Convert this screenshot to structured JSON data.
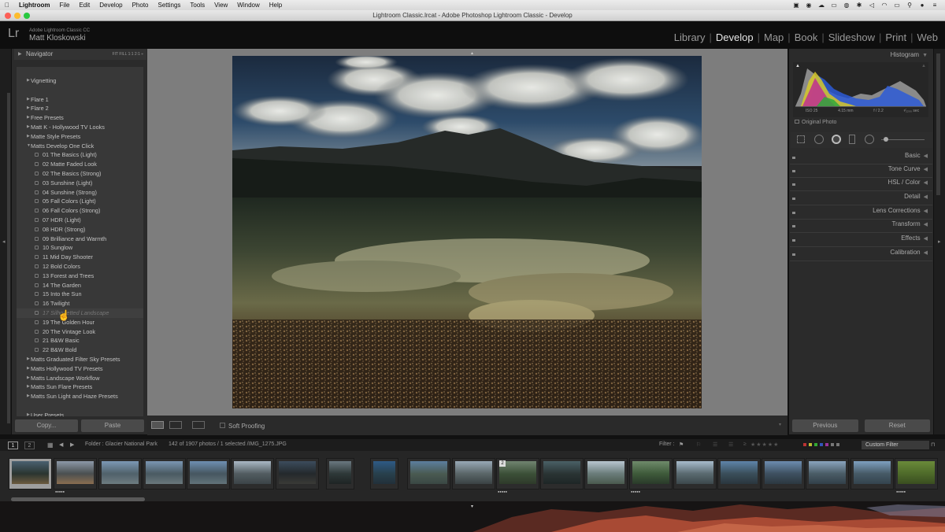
{
  "menubar": {
    "app": "Lightroom",
    "items": [
      "File",
      "Edit",
      "Develop",
      "Photo",
      "Settings",
      "Tools",
      "View",
      "Window",
      "Help"
    ]
  },
  "window_title": "Lightroom Classic.lrcat - Adobe Photoshop Lightroom Classic - Develop",
  "identity": {
    "logo": "Lr",
    "product": "Adobe Lightroom Classic CC",
    "user": "Matt Kloskowski"
  },
  "modules": [
    "Library",
    "Develop",
    "Map",
    "Book",
    "Slideshow",
    "Print",
    "Web"
  ],
  "active_module": "Develop",
  "navigator": {
    "title": "Navigator",
    "zoom_options": "FIT  FILL  1:1  2:1 ÷"
  },
  "presets": [
    {
      "type": "folder",
      "label": "Vignetting"
    },
    {
      "type": "gap"
    },
    {
      "type": "folder",
      "label": "Flare 1"
    },
    {
      "type": "folder",
      "label": "Flare 2"
    },
    {
      "type": "folder",
      "label": "Free Presets"
    },
    {
      "type": "folder",
      "label": "Matt K - Hollywood TV Looks"
    },
    {
      "type": "folder",
      "label": "Matte Style Presets"
    },
    {
      "type": "folder",
      "label": "Matts Develop One Click",
      "open": true
    },
    {
      "type": "item",
      "label": "01 The Basics (Light)"
    },
    {
      "type": "item",
      "label": "02 Matte Faded Look"
    },
    {
      "type": "item",
      "label": "02 The Basics (Strong)"
    },
    {
      "type": "item",
      "label": "03 Sunshine (Light)"
    },
    {
      "type": "item",
      "label": "04 Sunshine (Strong)"
    },
    {
      "type": "item",
      "label": "05 Fall Colors (Light)"
    },
    {
      "type": "item",
      "label": "06 Fall Colors (Strong)"
    },
    {
      "type": "item",
      "label": "07 HDR (Light)"
    },
    {
      "type": "item",
      "label": "08 HDR (Strong)"
    },
    {
      "type": "item",
      "label": "09 Brilliance and Warmth"
    },
    {
      "type": "item",
      "label": "10 Sunglow"
    },
    {
      "type": "item",
      "label": "11 Mid Day Shooter"
    },
    {
      "type": "item",
      "label": "12 Bold Colors"
    },
    {
      "type": "item",
      "label": "13 Forest and Trees"
    },
    {
      "type": "item",
      "label": "14 The Garden"
    },
    {
      "type": "item",
      "label": "15 Into the Sun"
    },
    {
      "type": "item",
      "label": "16 Twilight"
    },
    {
      "type": "item",
      "label": "17 Silhouetted Landscape",
      "hover": true
    },
    {
      "type": "item",
      "label": "19 The Golden Hour"
    },
    {
      "type": "item",
      "label": "20 The Vintage Look"
    },
    {
      "type": "item",
      "label": "21 B&W Basic"
    },
    {
      "type": "item",
      "label": "22 B&W Bold"
    },
    {
      "type": "folder",
      "label": "Matts Graduated Filter Sky Presets"
    },
    {
      "type": "folder",
      "label": "Matts Hollywood TV Presets"
    },
    {
      "type": "folder",
      "label": "Matts Landscape Workflow"
    },
    {
      "type": "folder",
      "label": "Matts Sun Flare Presets"
    },
    {
      "type": "folder",
      "label": "Matts Sun Light and Haze Presets"
    },
    {
      "type": "gap"
    },
    {
      "type": "folder",
      "label": "User Presets"
    }
  ],
  "left_buttons": {
    "copy": "Copy...",
    "paste": "Paste"
  },
  "toolbar": {
    "soft_proofing": "Soft Proofing"
  },
  "histogram": {
    "title": "Histogram",
    "iso": "ISO 25",
    "focal": "4.15 mm",
    "aperture": "f / 2.2",
    "shutter": "¹⁄₂₂₀₀ sec",
    "original_photo": "Original Photo"
  },
  "right_panels": [
    "Basic",
    "Tone Curve",
    "HSL / Color",
    "Detail",
    "Lens Corrections",
    "Transform",
    "Effects",
    "Calibration"
  ],
  "right_buttons": {
    "previous": "Previous",
    "reset": "Reset"
  },
  "filmstrip_header": {
    "screen1": "1",
    "screen2": "2",
    "source": "Folder : Glacier National Park",
    "count": "142 of 1907 photos / 1 selected /IMG_1275.JPG",
    "filter_label": "Filter :",
    "custom_filter": "Custom Filter"
  },
  "thumb_badge": "2",
  "colors": {
    "accent": "#e6e6e6",
    "panel": "#2b2b2b",
    "preview_bg": "#7d7d7d"
  }
}
